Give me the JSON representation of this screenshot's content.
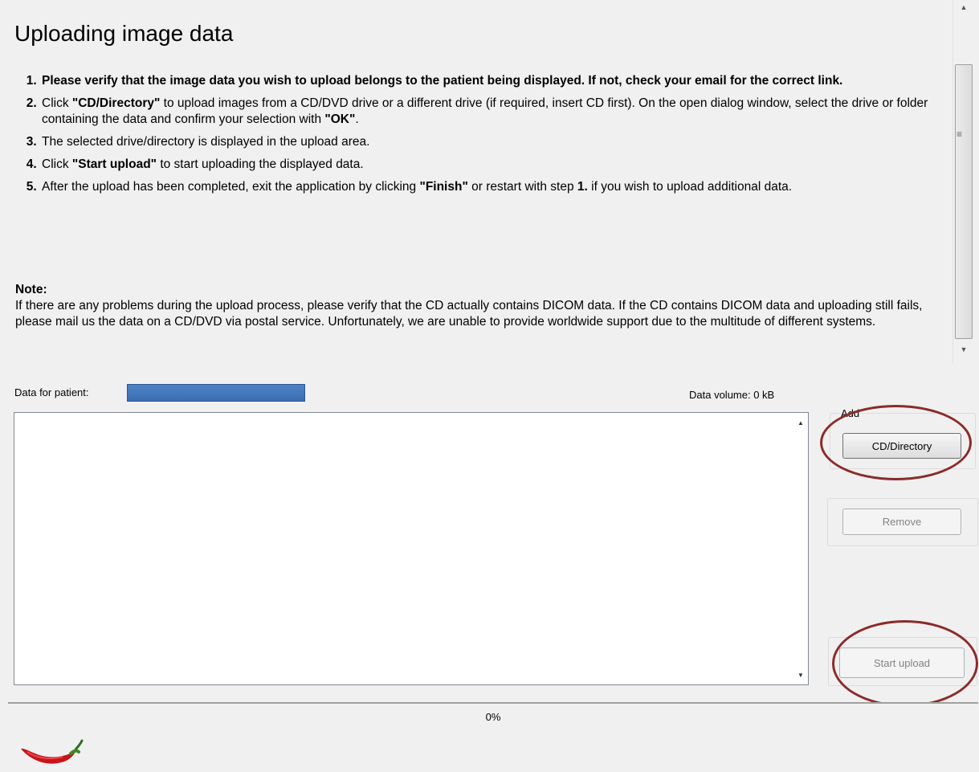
{
  "instructions": {
    "title": "Uploading image data",
    "steps": [
      {
        "html": "Please verify that the image data you wish to upload belongs to the patient being displayed. If not, check your email for the correct link."
      },
      {
        "parts": [
          [
            "Click ",
            false
          ],
          [
            "\"CD/Directory\"",
            true
          ],
          [
            " to upload images from a CD/DVD drive or a different drive (if required, insert CD first). On the open dialog window, select the drive or folder containing the data and confirm your selection with ",
            false
          ],
          [
            "\"OK\"",
            true
          ],
          [
            ".",
            false
          ]
        ]
      },
      {
        "parts": [
          [
            "The selected drive/directory is displayed in the upload area.",
            false
          ]
        ]
      },
      {
        "parts": [
          [
            "Click ",
            false
          ],
          [
            "\"Start upload\"",
            true
          ],
          [
            " to start uploading the displayed data.",
            false
          ]
        ]
      },
      {
        "parts": [
          [
            "After the upload has been completed, exit the application by clicking ",
            false
          ],
          [
            "\"Finish\"",
            true
          ],
          [
            " or restart with step ",
            false
          ],
          [
            "1.",
            true
          ],
          [
            " if you wish to upload additional data.",
            false
          ]
        ]
      }
    ],
    "note_title": "Note:",
    "note_text": "If there are any problems during the upload process, please verify that the CD actually contains DICOM data. If the CD contains DICOM data and uploading still fails, please mail us the data on a CD/DVD via postal service. Unfortunately, we are unable to provide worldwide support due to the multitude of different systems."
  },
  "patient": {
    "label": "Data for patient:",
    "name": ""
  },
  "volume_label": "Data volume: 0 kB",
  "add_group": {
    "label": "Add",
    "button": "CD/Directory"
  },
  "remove_button": "Remove",
  "start_button": "Start upload",
  "progress": {
    "percent": 0,
    "label": "0%"
  },
  "colors": {
    "accent": "#8b2b2b",
    "patient_field": "#4473b8"
  },
  "icons": {
    "logo": "chili-pepper-icon"
  }
}
